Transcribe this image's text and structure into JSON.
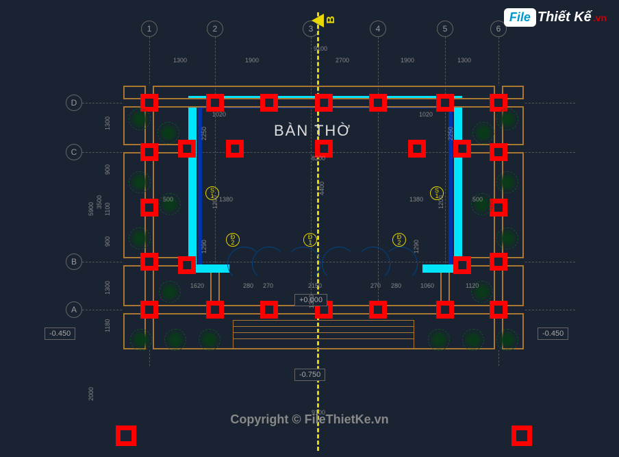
{
  "logo": {
    "box": "File",
    "text": "Thiết Kế",
    "suffix": ".vn"
  },
  "copyright": "Copyright © FileThietKe.vn",
  "section_label": "B",
  "room_label": "BÀN THỜ",
  "grid_numbers": [
    "1",
    "2",
    "3",
    "4",
    "5",
    "6"
  ],
  "grid_letters": [
    "A",
    "B",
    "C",
    "D"
  ],
  "dimensions": {
    "top_total": "9100",
    "top_segs": [
      "1300",
      "1900",
      "2700",
      "1900",
      "1300"
    ],
    "left_total": "5900",
    "left_outer": "2000",
    "left_segs": [
      "1300",
      "900",
      "1100",
      "900",
      "1300"
    ],
    "inner_1020_l": "1020",
    "inner_1020_r": "1020",
    "inner_2250_l": "2250",
    "inner_2250_r": "2250",
    "inner_1200_l": "1200",
    "inner_1200_r": "1200",
    "inner_1290_l": "1290",
    "inner_1290_r": "1290",
    "inner_1380_l": "1380",
    "inner_1380_r": "1380",
    "inner_500_l": "500",
    "inner_500_r": "500",
    "inner_8200": "8200",
    "inner_4400": "4400",
    "bottom_1620": "1620",
    "bottom_280a": "280",
    "bottom_2700a": "270",
    "bottom_2150": "2150",
    "bottom_270b": "270",
    "bottom_280b": "280",
    "bottom_1060": "1060",
    "bottom_1120": "1120",
    "bottom_1380": "1380",
    "bottom_9100": "9100",
    "left_3500": "3500",
    "left_1180": "1180"
  },
  "levels": {
    "zero": "+0.000",
    "minus_450_l": "-0.450",
    "minus_450_r": "-0.450",
    "minus_750": "-0.750"
  },
  "electrical": {
    "s1_l": "S\n1",
    "s1_r": "S\n1",
    "d1": "Đ\n1",
    "d2_l": "Đ\n2",
    "d2_r": "Đ\n2"
  }
}
